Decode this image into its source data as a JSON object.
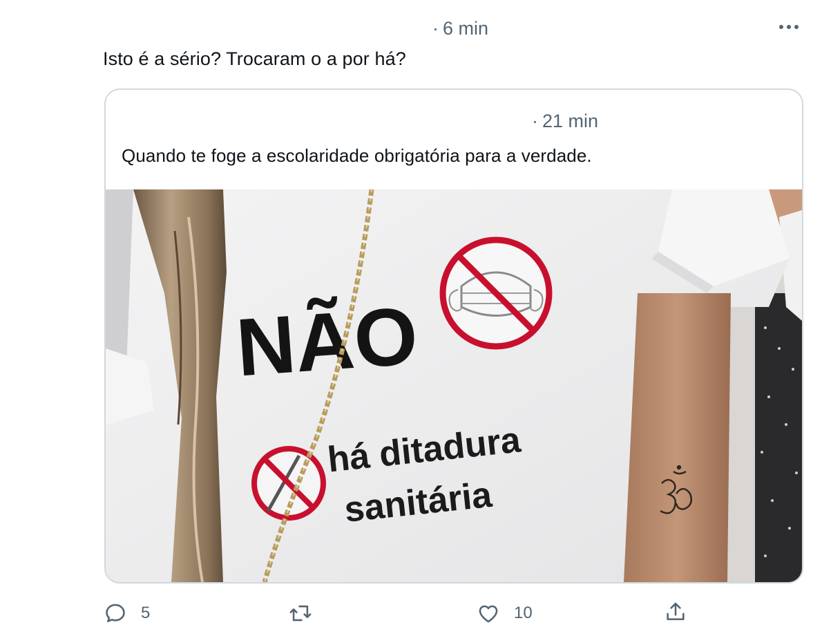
{
  "tweet": {
    "time": "6 min",
    "text": "Isto é a sério? Trocaram o a por há?"
  },
  "quoted_tweet": {
    "time": "21 min",
    "text": "Quando te foge a escolaridade obrigatória para a verdade.",
    "image": {
      "shirt_text_top": "NÃO",
      "shirt_text_line1": "há ditadura",
      "shirt_text_line2": "sanitária"
    }
  },
  "actions": {
    "reply_count": "5",
    "retweet_count": "",
    "like_count": "10"
  },
  "colors": {
    "secondary_text": "#536471",
    "border": "#cfd9de",
    "forbidden_red": "#c8102e"
  },
  "icons": {
    "more": "more-horizontal-icon",
    "reply": "reply-bubble-icon",
    "retweet": "retweet-arrows-icon",
    "like": "heart-outline-icon",
    "share": "share-upload-icon"
  }
}
